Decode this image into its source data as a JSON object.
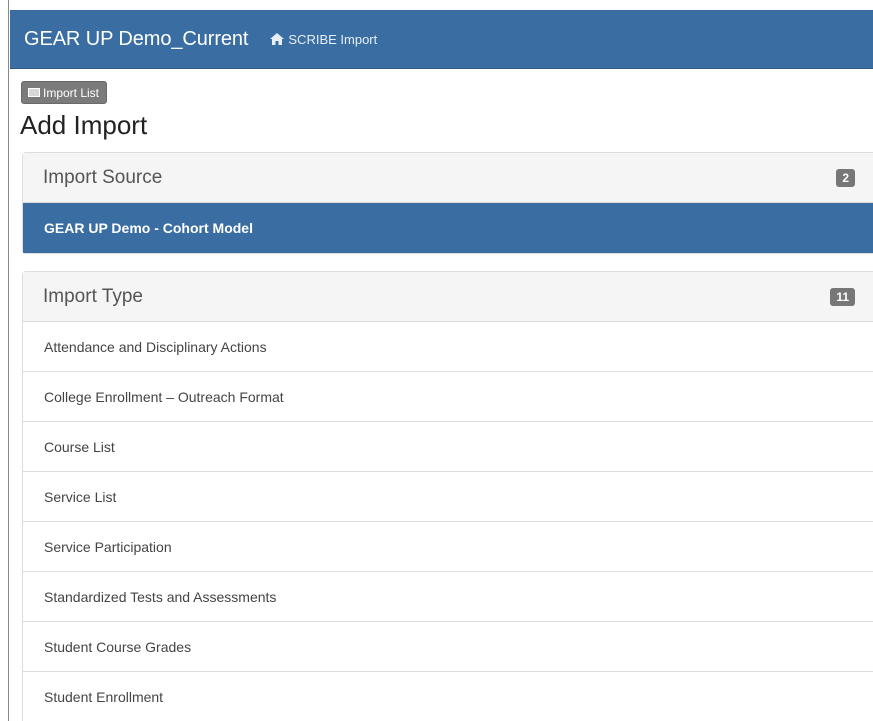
{
  "navbar": {
    "brand": "GEAR UP Demo_Current",
    "breadcrumb": "SCRIBE Import"
  },
  "toolbar": {
    "import_list_label": "Import List"
  },
  "page": {
    "title": "Add Import"
  },
  "import_source": {
    "heading": "Import Source",
    "count": "2",
    "items": [
      {
        "label": "GEAR UP Demo - Cohort Model",
        "selected": true
      }
    ]
  },
  "import_type": {
    "heading": "Import Type",
    "count": "11",
    "items": [
      {
        "label": "Attendance and Disciplinary Actions"
      },
      {
        "label": "College Enrollment – Outreach Format"
      },
      {
        "label": "Course List"
      },
      {
        "label": "Service List"
      },
      {
        "label": "Service Participation"
      },
      {
        "label": "Standardized Tests and Assessments"
      },
      {
        "label": "Student Course Grades"
      },
      {
        "label": "Student Enrollment"
      }
    ]
  },
  "colors": {
    "navbar": "#3a6ea2",
    "selected_item": "#3a6ea2",
    "badge": "#777777",
    "button": "#7b7b7b"
  },
  "icons": {
    "breadcrumb": "home-icon",
    "import_list": "list-icon"
  }
}
